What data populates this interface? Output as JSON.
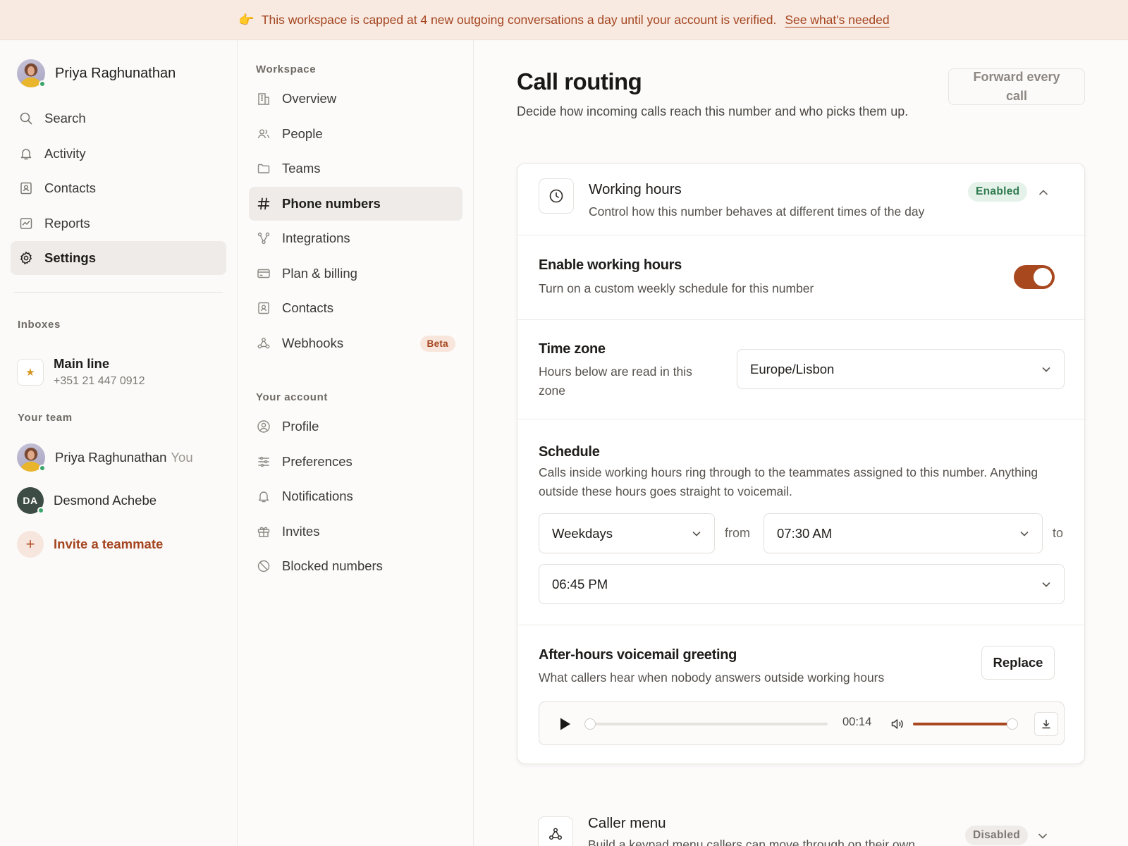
{
  "banner": {
    "emoji": "👉",
    "text": "This workspace is capped at 4 new outgoing conversations a day until your account is verified.",
    "link": "See what's needed"
  },
  "user": {
    "name": "Priya Raghunathan"
  },
  "sidebar": {
    "items": [
      {
        "label": "Search",
        "icon": "search-icon"
      },
      {
        "label": "Activity",
        "icon": "bell-icon"
      },
      {
        "label": "Contacts",
        "icon": "contact-card-icon"
      },
      {
        "label": "Reports",
        "icon": "chart-icon"
      },
      {
        "label": "Settings",
        "icon": "gear-icon",
        "active": true
      }
    ],
    "inboxes_label": "Inboxes",
    "inbox": {
      "name": "Main line",
      "number": "+351 21 447 0912"
    },
    "team_label": "Your team",
    "team": [
      {
        "name": "Priya Raghunathan",
        "suffix": "You"
      },
      {
        "name": "Desmond Achebe",
        "initials": "DA"
      }
    ],
    "invite_label": "Invite a teammate"
  },
  "subnav": {
    "workspace_label": "Workspace",
    "workspace": [
      {
        "label": "Overview",
        "icon": "building-icon"
      },
      {
        "label": "People",
        "icon": "people-icon"
      },
      {
        "label": "Teams",
        "icon": "folder-icon"
      },
      {
        "label": "Phone numbers",
        "icon": "hash-icon",
        "active": true
      },
      {
        "label": "Integrations",
        "icon": "integrations-icon"
      },
      {
        "label": "Plan & billing",
        "icon": "credit-card-icon"
      },
      {
        "label": "Contacts",
        "icon": "contact-card-icon"
      },
      {
        "label": "Webhooks",
        "icon": "webhook-icon",
        "badge": "Beta"
      }
    ],
    "account_label": "Your account",
    "account": [
      {
        "label": "Profile",
        "icon": "user-circle-icon"
      },
      {
        "label": "Preferences",
        "icon": "sliders-icon"
      },
      {
        "label": "Notifications",
        "icon": "bell-icon"
      },
      {
        "label": "Invites",
        "icon": "gift-icon"
      },
      {
        "label": "Blocked numbers",
        "icon": "block-icon"
      }
    ]
  },
  "main": {
    "title": "Call routing",
    "subtitle": "Decide how incoming calls reach this number and who picks them up.",
    "forward_button": "Forward every call",
    "working_hours": {
      "title": "Working hours",
      "subtitle": "Control how this number behaves at different times of the day",
      "status": "Enabled",
      "enable": {
        "title": "Enable working hours",
        "subtitle": "Turn on a custom weekly schedule for this number",
        "on": true
      },
      "timezone": {
        "title": "Time zone",
        "subtitle": "Hours below are read in this zone",
        "value": "Europe/Lisbon"
      },
      "schedule": {
        "title": "Schedule",
        "subtitle": "Calls inside working hours ring through to the teammates assigned to this number. Anything outside these hours goes straight to voicemail.",
        "days": "Weekdays",
        "from_label": "from",
        "from": "07:30 AM",
        "to_label": "to",
        "to": "06:45 PM"
      },
      "voicemail": {
        "title": "After-hours voicemail greeting",
        "subtitle": "What callers hear when nobody answers outside working hours",
        "replace_button": "Replace",
        "duration": "00:14",
        "progress": 0,
        "volume": 0.95
      }
    },
    "caller_menu": {
      "title": "Caller menu",
      "subtitle": "Build a keypad menu callers can move through on their own",
      "status": "Disabled"
    }
  },
  "colors": {
    "accent": "#a8481f",
    "banner_bg": "#f8e9e1",
    "enabled_bg": "#e5f2ea",
    "enabled_text": "#2f7a4e"
  }
}
